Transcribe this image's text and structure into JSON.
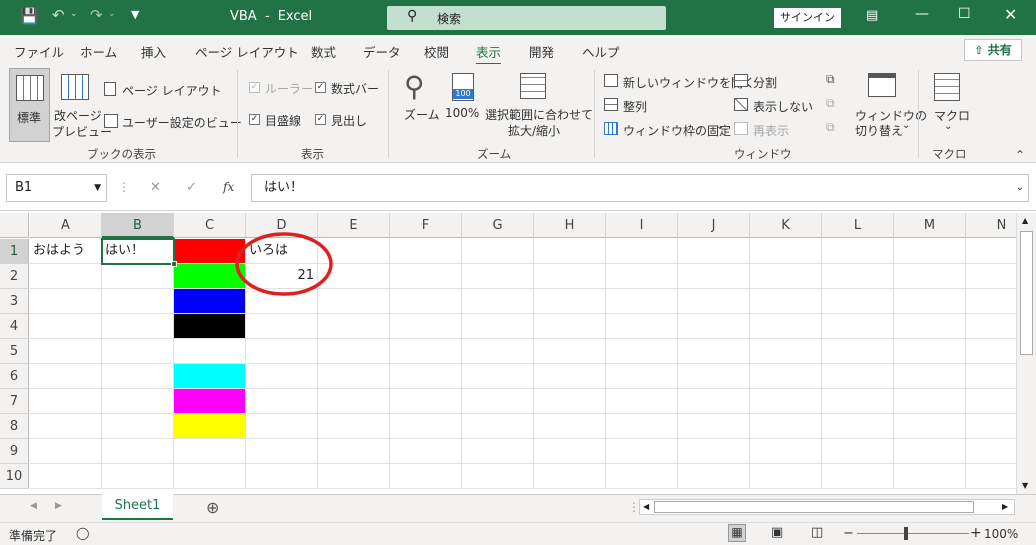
{
  "title_bar": {
    "file_title": "VBA",
    "separator": "-",
    "app_name": "Excel",
    "search_placeholder": "検索",
    "signin_label": "サインイン"
  },
  "menu_tabs": [
    "ファイル",
    "ホーム",
    "挿入",
    "ページ レイアウト",
    "数式",
    "データ",
    "校閲",
    "表示",
    "開発",
    "ヘルプ"
  ],
  "active_tab": "表示",
  "share_label": "共有",
  "ribbon": {
    "workbook_views": {
      "label": "ブックの表示",
      "normal": "標準",
      "page_break_1": "改ページ",
      "page_break_2": "プレビュー",
      "page_layout": "ページ レイアウト",
      "custom_views": "ユーザー設定のビュー"
    },
    "show": {
      "label": "表示",
      "ruler": "ルーラー",
      "formula_bar": "数式バー",
      "gridlines": "目盛線",
      "headings": "見出し"
    },
    "zoom": {
      "label": "ズーム",
      "zoom": "ズーム",
      "zoom100": "100%",
      "zoom100_icon_text": "100",
      "zoom_selection_1": "選択範囲に合わせて",
      "zoom_selection_2": "拡大/縮小"
    },
    "window": {
      "label": "ウィンドウ",
      "new_window": "新しいウィンドウを開く",
      "arrange": "整列",
      "freeze": "ウィンドウ枠の固定",
      "split": "分割",
      "hide": "表示しない",
      "unhide": "再表示",
      "switch_1": "ウィンドウの",
      "switch_2": "切り替え"
    },
    "macros": {
      "label": "マクロ",
      "macros": "マクロ",
      "chevron": "⌄"
    }
  },
  "formula_bar": {
    "name_box": "B1",
    "fx": "fx",
    "cancel": "✕",
    "enter": "✓",
    "content": "はい！"
  },
  "columns": [
    "A",
    "B",
    "C",
    "D",
    "E",
    "F",
    "G",
    "H",
    "I",
    "J",
    "K",
    "L",
    "M",
    "N"
  ],
  "selected_column": "B",
  "rows": [
    "1",
    "2",
    "3",
    "4",
    "5",
    "6",
    "7",
    "8",
    "9",
    "10"
  ],
  "selected_row": "1",
  "cells": {
    "A1": "おはよう",
    "B1": "はい！",
    "D1": "いろは",
    "D2": "21"
  },
  "cell_fills": {
    "C1": "#FF0000",
    "C2": "#00FF00",
    "C3": "#0000FF",
    "C4": "#000000",
    "C6": "#00FFFF",
    "C7": "#FF00FF",
    "C8": "#FFFF00"
  },
  "annotation_color": "#E02020",
  "sheet_tabs": [
    "Sheet1"
  ],
  "add_sheet": "⊕",
  "status": {
    "ready": "準備完了",
    "zoom_minus": "−",
    "zoom_plus": "+",
    "zoom": "100%"
  },
  "colors": {
    "accent": "#217346",
    "title_bar_bg": "#217346",
    "ribbon_bg": "#F3F2F1"
  }
}
